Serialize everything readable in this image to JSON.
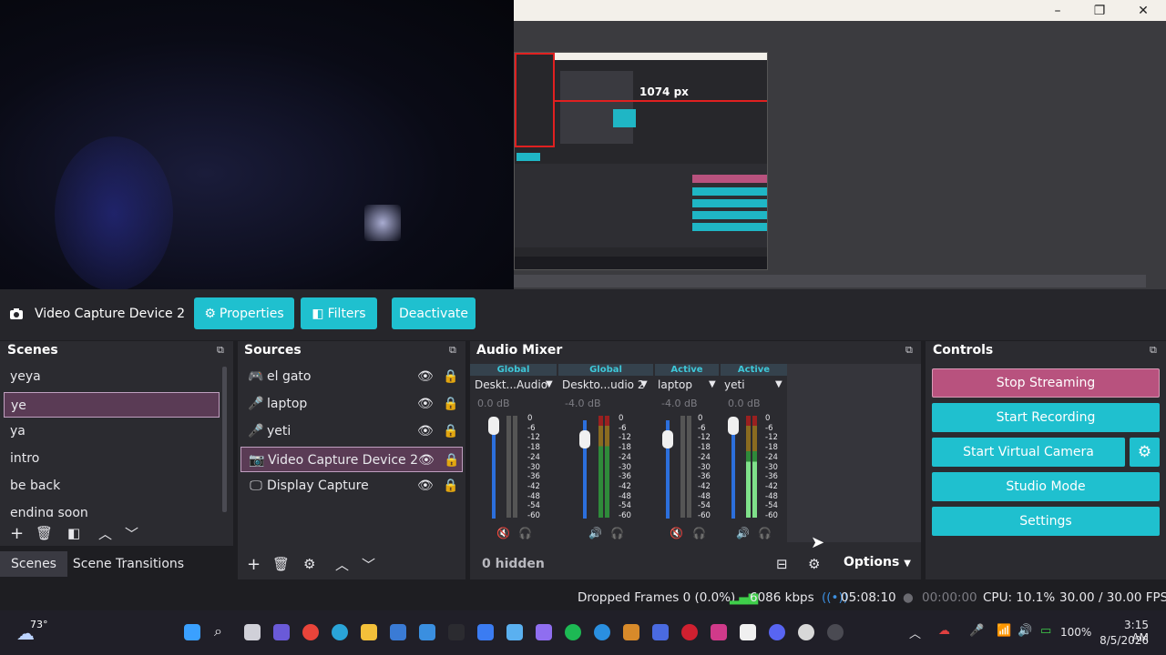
{
  "preview": {
    "measure_label": "1074 px",
    "window_controls": {
      "minimize": "–",
      "restore": "❐",
      "close": "✕"
    }
  },
  "source_toolbar": {
    "source_name": "Video Capture Device 2",
    "properties_label": "Properties",
    "filters_label": "Filters",
    "deactivate_label": "Deactivate"
  },
  "scenes": {
    "title": "Scenes",
    "items": [
      "yeya",
      "ye",
      "ya",
      "intro",
      "be back",
      "ending soon"
    ],
    "selected": "ye"
  },
  "sources": {
    "title": "Sources",
    "items": [
      {
        "name": "el gato",
        "icon": "gamepad-icon"
      },
      {
        "name": "laptop",
        "icon": "microphone-icon"
      },
      {
        "name": "yeti",
        "icon": "microphone-icon"
      },
      {
        "name": "Video Capture Device 2",
        "icon": "camera-icon"
      },
      {
        "name": "Display Capture",
        "icon": "monitor-icon"
      }
    ],
    "selected": "Video Capture Device 2"
  },
  "audio_mixer": {
    "title": "Audio Mixer",
    "channels": [
      {
        "tag": "Global",
        "name": "Deskt...Audio",
        "db": "0.0 dB",
        "fader_level": 0.92,
        "muted": true
      },
      {
        "tag": "Global",
        "name": "Deskto...udio 2",
        "db": "-4.0 dB",
        "fader_level": 0.8,
        "muted": false
      },
      {
        "tag": "Active",
        "name": "laptop",
        "db": "-4.0 dB",
        "fader_level": 0.8,
        "muted": true
      },
      {
        "tag": "Active",
        "name": "yeti",
        "db": "0.0 dB",
        "fader_level": 0.92,
        "muted": false
      }
    ],
    "scale": [
      "0",
      "-6",
      "-12",
      "-18",
      "-24",
      "-30",
      "-36",
      "-42",
      "-48",
      "-54",
      "-60"
    ],
    "hidden_label": "0 hidden",
    "options_label": "Options"
  },
  "controls": {
    "title": "Controls",
    "stop_streaming": "Stop Streaming",
    "start_recording": "Start Recording",
    "start_virtual_camera": "Start Virtual Camera",
    "studio_mode": "Studio Mode",
    "settings": "Settings",
    "stop_color": "#b8527e",
    "accent": "#1fc0cf"
  },
  "tabs": {
    "scenes": "Scenes",
    "scene_transitions": "Scene Transitions"
  },
  "status": {
    "dropped_frames": "Dropped Frames 0 (0.0%)",
    "bitrate": "6086 kbps",
    "stream_time": "05:08:10",
    "record_time": "00:00:00",
    "cpu": "CPU: 10.1%",
    "fps": "30.00 / 30.00 FPS"
  },
  "taskbar": {
    "weather": "73°",
    "battery": "100%",
    "time": "3:15 AM",
    "date": "8/5/2026"
  }
}
